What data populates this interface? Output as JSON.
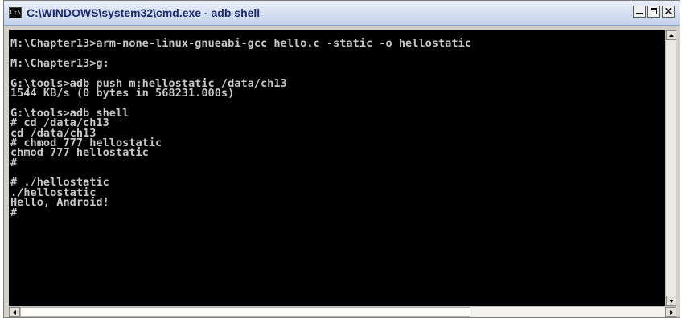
{
  "window": {
    "title": "C:\\WINDOWS\\system32\\cmd.exe - adb shell",
    "icon": "console-icon",
    "icon_glyph": "C:\\"
  },
  "console": {
    "lines": [
      "M:\\Chapter13>arm-none-linux-gnueabi-gcc hello.c -static -o hellostatic",
      "",
      "M:\\Chapter13>g:",
      "",
      "G:\\tools>adb push m:hellostatic /data/ch13",
      "1544 KB/s (0 bytes in 568231.000s)",
      "",
      "G:\\tools>adb shell",
      "# cd /data/ch13",
      "cd /data/ch13",
      "# chmod 777 hellostatic",
      "chmod 777 hellostatic",
      "#",
      "",
      "# ./hellostatic",
      "./hellostatic",
      "Hello, Android!",
      "#"
    ]
  },
  "colors": {
    "console_bg": "#000000",
    "console_text": "#c8c8c8",
    "title_text": "#1a2a6b"
  }
}
